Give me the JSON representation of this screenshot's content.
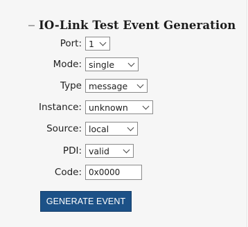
{
  "section": {
    "collapse_symbol": "−",
    "title": "IO-Link Test Event Generation"
  },
  "form": {
    "port": {
      "label": "Port:",
      "value": "1"
    },
    "mode": {
      "label": "Mode:",
      "value": "single"
    },
    "type": {
      "label": "Type",
      "value": "message"
    },
    "instance": {
      "label": "Instance:",
      "value": "unknown"
    },
    "source": {
      "label": "Source:",
      "value": "local"
    },
    "pdi": {
      "label": "PDI:",
      "value": "valid"
    },
    "code": {
      "label": "Code:",
      "value": "0x0000"
    }
  },
  "actions": {
    "generate_label": "GENERATE EVENT"
  },
  "colors": {
    "button_background": "#1c5187",
    "button_text": "#ffffff",
    "panel_background": "#f6f6f6"
  },
  "icons": {
    "collapse": "minus-icon",
    "dropdown": "chevron-down-icon"
  }
}
